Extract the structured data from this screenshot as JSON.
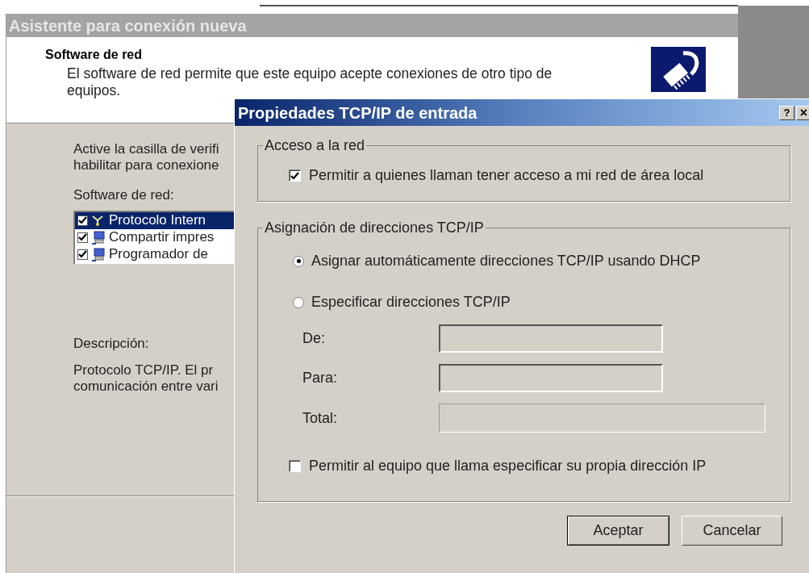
{
  "wizard": {
    "title": "Asistente para conexión nueva",
    "header_title": "Software de red",
    "header_text": "El software de red permite que este equipo acepte conexiones de otro tipo de equipos.",
    "instructions": [
      "Active la casilla de verifi",
      "habilitar para conexione"
    ],
    "list_label": "Software de red:",
    "items": [
      {
        "kind": "protocol",
        "label": "Protocolo Intern",
        "checked": true,
        "selected": true
      },
      {
        "kind": "computer",
        "label": "Compartir impres",
        "checked": true,
        "selected": false
      },
      {
        "kind": "computer",
        "label": "Programador de",
        "checked": true,
        "selected": false
      }
    ],
    "description_label": "Descripción:",
    "description_lines": [
      "Protocolo TCP/IP. El pr",
      "comunicación entre vari"
    ]
  },
  "dialog": {
    "title": "Propiedades TCP/IP de entrada",
    "help_button": "?",
    "close_button": "×",
    "network_access": {
      "title": "Acceso a la red",
      "checkbox": {
        "label": "Permitir a quienes llaman tener acceso a mi red de área local",
        "checked": true
      }
    },
    "addressing": {
      "title": "Asignación de direcciones TCP/IP",
      "options": [
        {
          "label": "Asignar automáticamente direcciones TCP/IP usando DHCP",
          "selected": true
        },
        {
          "label": "Especificar direcciones TCP/IP",
          "selected": false
        }
      ],
      "fields": [
        {
          "kind": "ip",
          "label": "De:",
          "disabled": true
        },
        {
          "kind": "ip",
          "label": "Para:",
          "disabled": true
        },
        {
          "kind": "text",
          "label": "Total:",
          "disabled": true
        }
      ],
      "own_ip": {
        "label": "Permitir al equipo que llama especificar su propia dirección IP",
        "checked": false
      }
    },
    "buttons": [
      {
        "label": "Aceptar",
        "default": true
      },
      {
        "label": "Cancelar",
        "default": false
      }
    ]
  }
}
